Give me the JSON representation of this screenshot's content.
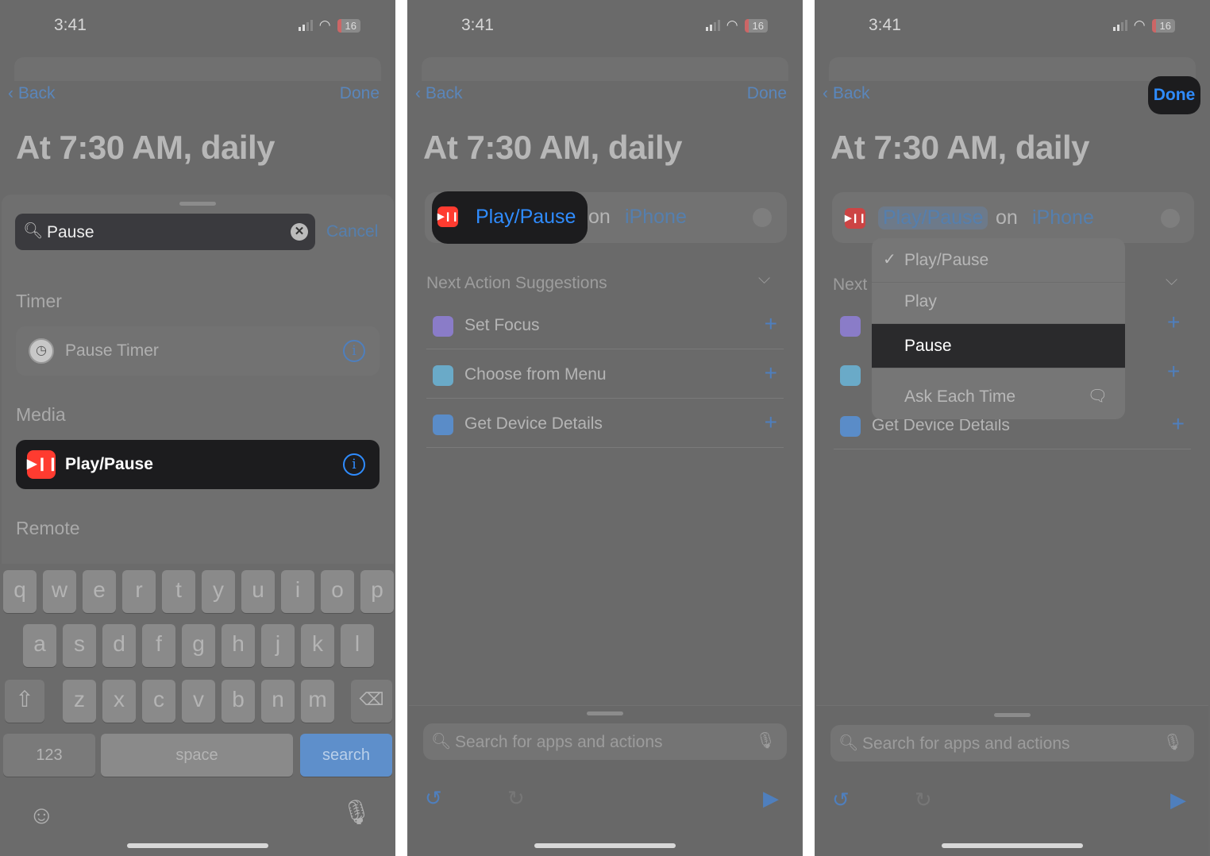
{
  "colors": {
    "accent": "#0a84ff",
    "play_pause_icon": "#ff3b30",
    "dim_overlay": "#6a6a6a"
  },
  "status": {
    "time": "3:41",
    "battery": "16"
  },
  "nav": {
    "back": "Back",
    "done": "Done"
  },
  "title": "At 7:30 AM, daily",
  "screen1": {
    "search": {
      "value": "Pause",
      "cancel": "Cancel"
    },
    "sections": [
      {
        "header": "Timer",
        "items": [
          {
            "label": "Pause Timer",
            "icon": "clock-icon"
          }
        ]
      },
      {
        "header": "Media",
        "items": [
          {
            "label": "Play/Pause",
            "icon": "play-pause-icon",
            "highlighted": true
          }
        ]
      },
      {
        "header": "Remote"
      }
    ],
    "keyboard": {
      "rows": [
        [
          "q",
          "w",
          "e",
          "r",
          "t",
          "y",
          "u",
          "i",
          "o",
          "p"
        ],
        [
          "a",
          "s",
          "d",
          "f",
          "g",
          "h",
          "j",
          "k",
          "l"
        ],
        [
          "z",
          "x",
          "c",
          "v",
          "b",
          "n",
          "m"
        ]
      ],
      "numbers": "123",
      "space": "space",
      "search": "search"
    }
  },
  "screen2": {
    "action": {
      "verb": "Play/Pause",
      "on": "on",
      "device": "iPhone"
    },
    "suggestions_header": "Next Action Suggestions",
    "suggestions": [
      {
        "label": "Set Focus",
        "icon": "moon-icon",
        "color": "#8a7cc8"
      },
      {
        "label": "Choose from Menu",
        "icon": "menu-icon",
        "color": "#6aaac8"
      },
      {
        "label": "Get Device Details",
        "icon": "phone-icon",
        "color": "#5a8cc8"
      }
    ],
    "search_placeholder": "Search for apps and actions"
  },
  "screen3": {
    "suggestions_header_partial": "Next",
    "visible_suggestion": "Get Device Details",
    "menu": [
      {
        "label": "Play/Pause",
        "checked": true
      },
      {
        "label": "Play"
      },
      {
        "label": "Pause",
        "selected": true
      },
      {
        "label": "Ask Each Time"
      }
    ]
  }
}
